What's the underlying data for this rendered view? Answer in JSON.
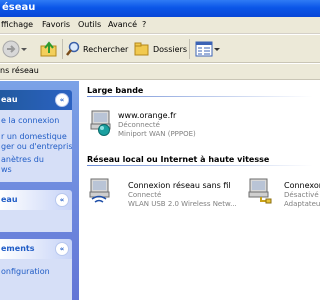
{
  "window": {
    "title": "éseau"
  },
  "menu": [
    "ffichage",
    "Favoris",
    "Outils",
    "Avancé",
    "?"
  ],
  "toolbar": {
    "search_label": "Rechercher",
    "folders_label": "Dossiers"
  },
  "address": {
    "text": "ns réseau"
  },
  "sidebar": {
    "panel1": {
      "title": "eau",
      "items": [
        "e la connexion",
        "r un domestique",
        "ger ou d'entreprise",
        "anètres du",
        "ws"
      ]
    },
    "panel2": {
      "title": "eau"
    },
    "panel3": {
      "title": "ements",
      "items": [
        "onfiguration"
      ]
    }
  },
  "main": {
    "group1": {
      "title": "Large bande",
      "connection": {
        "name": "www.orange.fr",
        "status": "Déconnecté",
        "device": "Miniport WAN (PPPOE)"
      }
    },
    "group2": {
      "title": "Réseau local ou Internet à haute vitesse",
      "connections": [
        {
          "name": "Connexion réseau sans fil",
          "status": "Connecté",
          "device": "WLAN USB 2.0 Wireless Netw..."
        },
        {
          "name": "Connexon",
          "status": "Désactivé",
          "device": "Adaptateur"
        }
      ]
    }
  }
}
